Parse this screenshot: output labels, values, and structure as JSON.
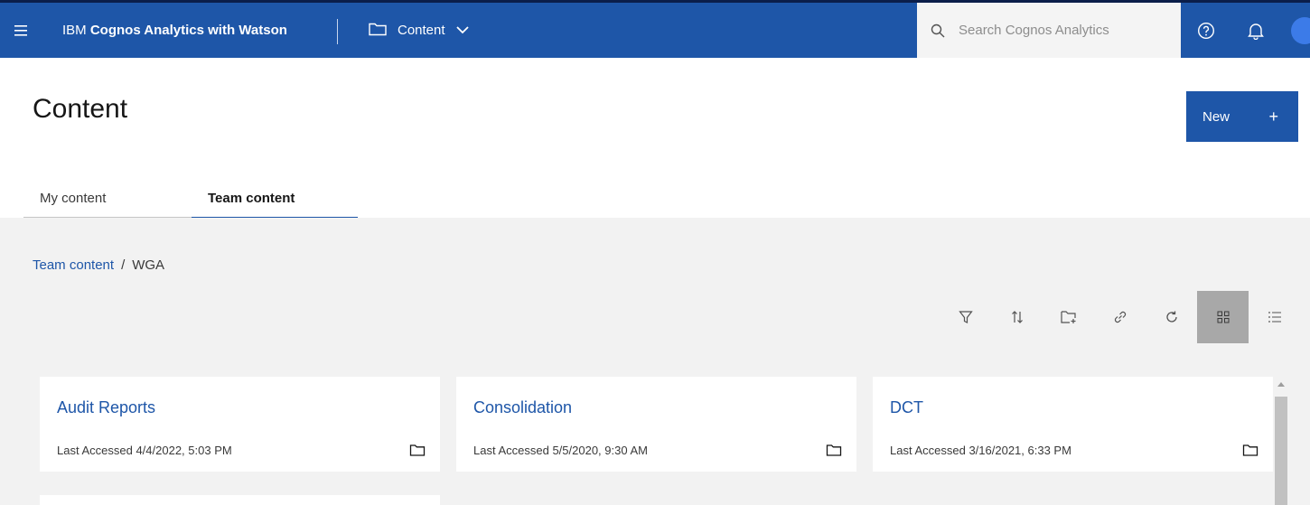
{
  "header": {
    "app_name_prefix": "IBM ",
    "app_name_bold": "Cognos Analytics with Watson",
    "location_label": "Content",
    "search_placeholder": "Search Cognos Analytics",
    "icons": [
      "menu-icon",
      "folder-icon",
      "chevron-down-icon",
      "search-icon",
      "help-icon",
      "notification-bell-icon",
      "avatar"
    ]
  },
  "page": {
    "title": "Content",
    "new_button_label": "New",
    "new_button_icon": "+"
  },
  "tabs": [
    {
      "label": "My content",
      "selected": false
    },
    {
      "label": "Team content",
      "selected": true
    }
  ],
  "breadcrumb": {
    "root": "Team content",
    "separator": "/",
    "current": "WGA"
  },
  "toolbar": {
    "tools": [
      "filter-icon",
      "sort-icon",
      "new-folder-icon",
      "link-icon",
      "refresh-icon",
      "grid-view-icon",
      "list-view-icon"
    ],
    "active_view": "grid-view-icon"
  },
  "cards": [
    {
      "title": "Audit Reports",
      "meta_label": "Last Accessed",
      "meta_value": "4/4/2022, 5:03 PM",
      "icon": "folder-icon"
    },
    {
      "title": "Consolidation",
      "meta_label": "Last Accessed",
      "meta_value": "5/5/2020, 9:30 AM",
      "icon": "folder-icon"
    },
    {
      "title": "DCT",
      "meta_label": "Last Accessed",
      "meta_value": "3/16/2021, 6:33 PM",
      "icon": "folder-icon"
    }
  ],
  "colors": {
    "brand": "#1e56a8",
    "workspace_bg": "#f2f2f2",
    "active_tool_bg": "#a8a8a8"
  }
}
